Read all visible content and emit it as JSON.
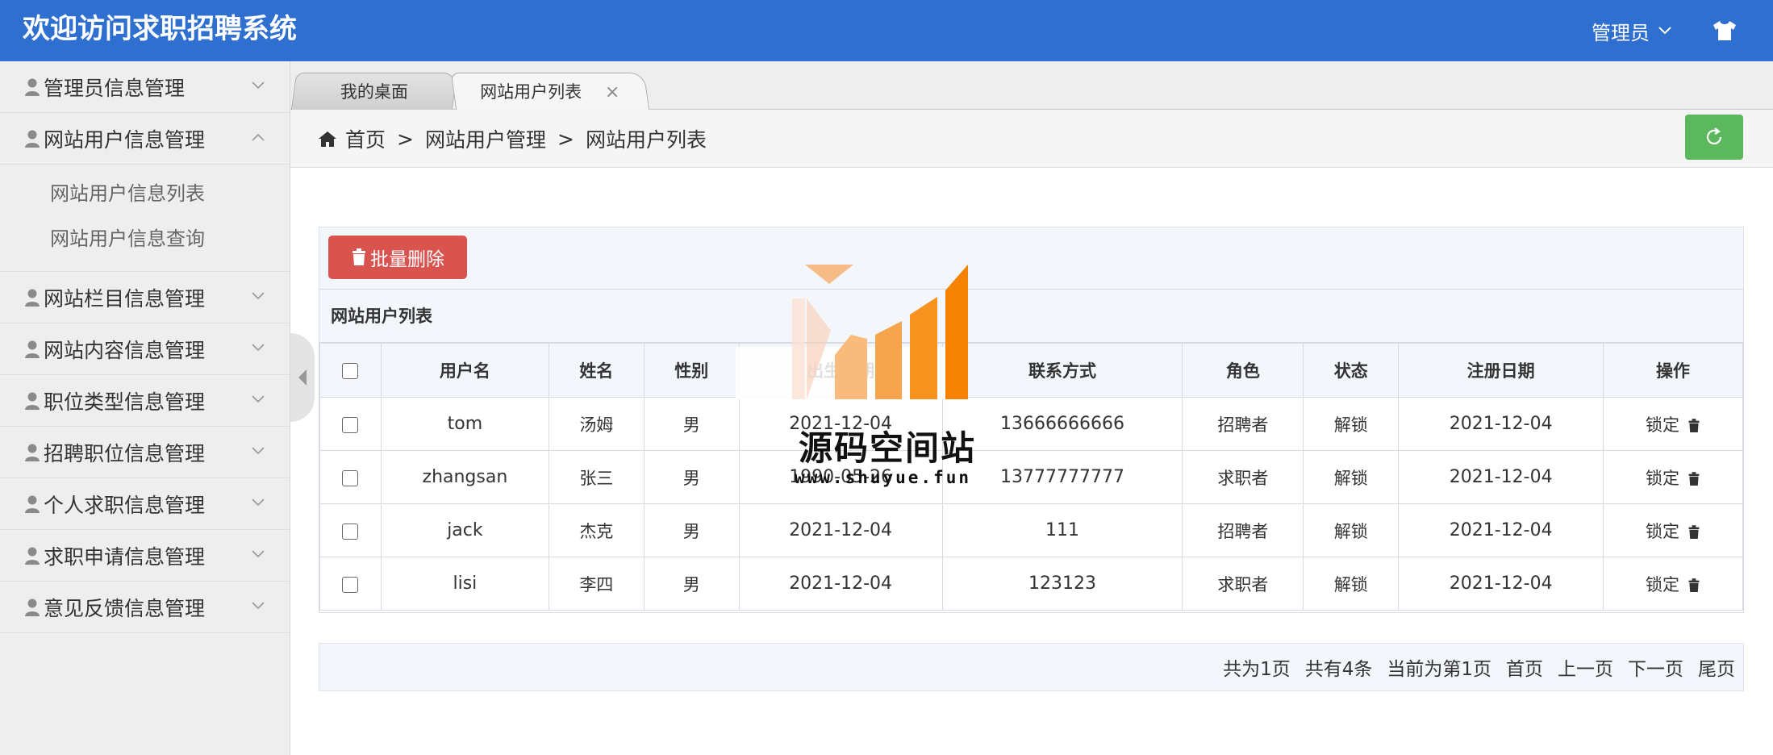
{
  "header": {
    "title": "欢迎访问求职招聘系统",
    "admin_label": "管理员"
  },
  "sidebar": {
    "items": [
      {
        "label": "管理员信息管理",
        "expanded": false
      },
      {
        "label": "网站用户信息管理",
        "expanded": true,
        "children": [
          "网站用户信息列表",
          "网站用户信息查询"
        ]
      },
      {
        "label": "网站栏目信息管理",
        "expanded": false
      },
      {
        "label": "网站内容信息管理",
        "expanded": false
      },
      {
        "label": "职位类型信息管理",
        "expanded": false
      },
      {
        "label": "招聘职位信息管理",
        "expanded": false
      },
      {
        "label": "个人求职信息管理",
        "expanded": false
      },
      {
        "label": "求职申请信息管理",
        "expanded": false
      },
      {
        "label": "意见反馈信息管理",
        "expanded": false
      }
    ]
  },
  "tabs": [
    {
      "label": "我的桌面",
      "active": false
    },
    {
      "label": "网站用户列表",
      "active": true
    }
  ],
  "breadcrumb": {
    "home": "首页",
    "level1": "网站用户管理",
    "level2": "网站用户列表",
    "separator": ">"
  },
  "toolbar": {
    "batch_delete_label": "批量删除"
  },
  "panel": {
    "title": "网站用户列表"
  },
  "table": {
    "columns": [
      "用户名",
      "姓名",
      "性别",
      "出生日期",
      "联系方式",
      "角色",
      "状态",
      "注册日期",
      "操作"
    ],
    "rows": [
      {
        "username": "tom",
        "name": "汤姆",
        "gender": "男",
        "birth": "2021-12-04",
        "contact": "13666666666",
        "role": "招聘者",
        "status": "解锁",
        "reg_date": "2021-12-04",
        "action": "锁定"
      },
      {
        "username": "zhangsan",
        "name": "张三",
        "gender": "男",
        "birth": "1990-05-26",
        "contact": "13777777777",
        "role": "求职者",
        "status": "解锁",
        "reg_date": "2021-12-04",
        "action": "锁定"
      },
      {
        "username": "jack",
        "name": "杰克",
        "gender": "男",
        "birth": "2021-12-04",
        "contact": "111",
        "role": "招聘者",
        "status": "解锁",
        "reg_date": "2021-12-04",
        "action": "锁定"
      },
      {
        "username": "lisi",
        "name": "李四",
        "gender": "男",
        "birth": "2021-12-04",
        "contact": "123123",
        "role": "求职者",
        "status": "解锁",
        "reg_date": "2021-12-04",
        "action": "锁定"
      }
    ]
  },
  "pager": {
    "total_pages": "共为1页",
    "total_items": "共有4条",
    "current": "当前为第1页",
    "first": "首页",
    "prev": "上一页",
    "next": "下一页",
    "last": "尾页"
  },
  "watermark": {
    "text": "源码空间站",
    "url": "www.shuyue.fun"
  },
  "colors": {
    "header": "#2e6fcf",
    "danger": "#d9534f",
    "success": "#5cb85c",
    "sidebar": "#eeeeee"
  }
}
